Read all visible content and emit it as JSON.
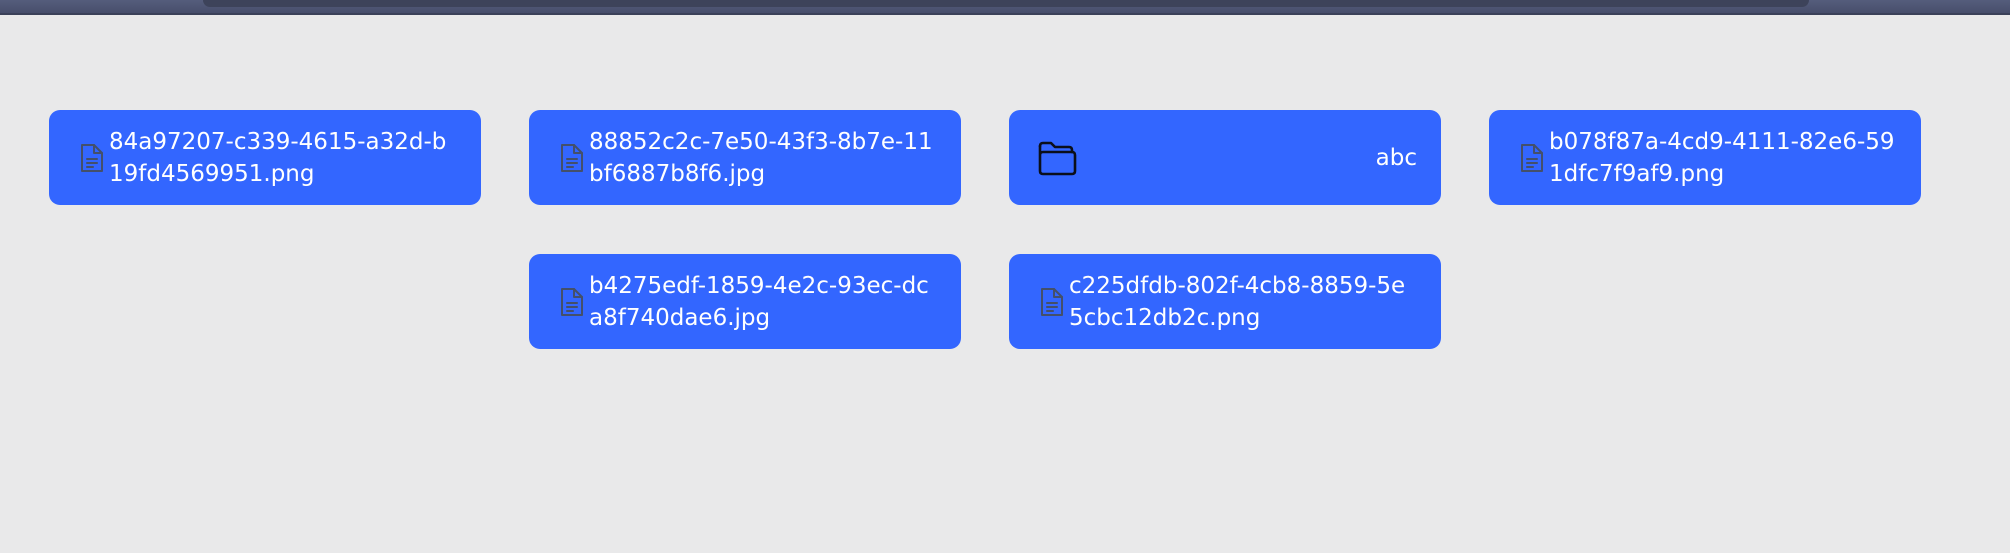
{
  "files": [
    {
      "id": "f1",
      "type": "file",
      "name": "84a97207-c339-4615-a32d-b19fd4569951.png",
      "icon": "file-icon"
    },
    {
      "id": "f2",
      "type": "file",
      "name": "88852c2c-7e50-43f3-8b7e-11bf6887b8f6.jpg",
      "icon": "file-icon"
    },
    {
      "id": "f3",
      "type": "folder",
      "name": "abc",
      "icon": "folder-icon"
    },
    {
      "id": "f4",
      "type": "file",
      "name": "b078f87a-4cd9-4111-82e6-591dfc7f9af9.png",
      "icon": "file-icon"
    },
    {
      "id": "f5",
      "type": "file",
      "name": "b4275edf-1859-4e2c-93ec-dca8f740dae6.jpg",
      "icon": "file-icon"
    },
    {
      "id": "f6",
      "type": "file",
      "name": "c225dfdb-802f-4cb8-8859-5e5cbc12db2c.png",
      "icon": "file-icon"
    }
  ],
  "colors": {
    "background": "#e9e9ea",
    "tile": "#3366ff",
    "tile_text": "#ffffff",
    "file_icon_stroke": "#44506a",
    "folder_icon_stroke": "#0b0f1a",
    "topbar": "#4f5674"
  }
}
